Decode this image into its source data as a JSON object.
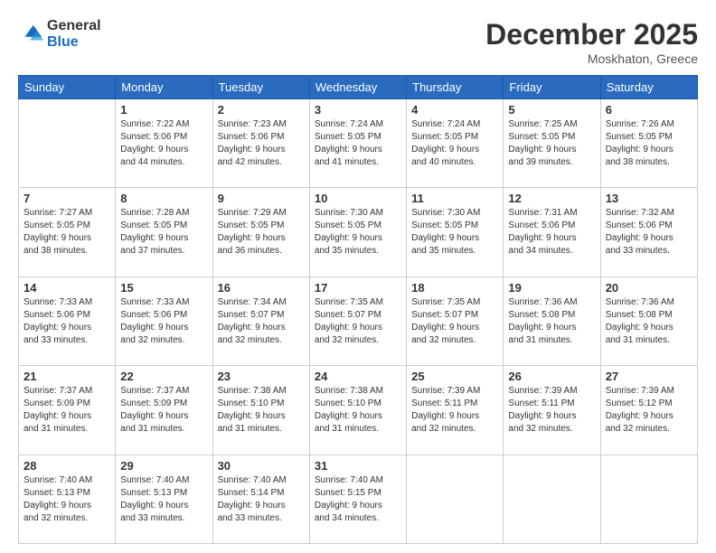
{
  "logo": {
    "general": "General",
    "blue": "Blue"
  },
  "header": {
    "month": "December 2025",
    "location": "Moskhaton, Greece"
  },
  "weekdays": [
    "Sunday",
    "Monday",
    "Tuesday",
    "Wednesday",
    "Thursday",
    "Friday",
    "Saturday"
  ],
  "weeks": [
    [
      {
        "day": "",
        "info": ""
      },
      {
        "day": "1",
        "info": "Sunrise: 7:22 AM\nSunset: 5:06 PM\nDaylight: 9 hours\nand 44 minutes."
      },
      {
        "day": "2",
        "info": "Sunrise: 7:23 AM\nSunset: 5:06 PM\nDaylight: 9 hours\nand 42 minutes."
      },
      {
        "day": "3",
        "info": "Sunrise: 7:24 AM\nSunset: 5:05 PM\nDaylight: 9 hours\nand 41 minutes."
      },
      {
        "day": "4",
        "info": "Sunrise: 7:24 AM\nSunset: 5:05 PM\nDaylight: 9 hours\nand 40 minutes."
      },
      {
        "day": "5",
        "info": "Sunrise: 7:25 AM\nSunset: 5:05 PM\nDaylight: 9 hours\nand 39 minutes."
      },
      {
        "day": "6",
        "info": "Sunrise: 7:26 AM\nSunset: 5:05 PM\nDaylight: 9 hours\nand 38 minutes."
      }
    ],
    [
      {
        "day": "7",
        "info": "Sunrise: 7:27 AM\nSunset: 5:05 PM\nDaylight: 9 hours\nand 38 minutes."
      },
      {
        "day": "8",
        "info": "Sunrise: 7:28 AM\nSunset: 5:05 PM\nDaylight: 9 hours\nand 37 minutes."
      },
      {
        "day": "9",
        "info": "Sunrise: 7:29 AM\nSunset: 5:05 PM\nDaylight: 9 hours\nand 36 minutes."
      },
      {
        "day": "10",
        "info": "Sunrise: 7:30 AM\nSunset: 5:05 PM\nDaylight: 9 hours\nand 35 minutes."
      },
      {
        "day": "11",
        "info": "Sunrise: 7:30 AM\nSunset: 5:05 PM\nDaylight: 9 hours\nand 35 minutes."
      },
      {
        "day": "12",
        "info": "Sunrise: 7:31 AM\nSunset: 5:06 PM\nDaylight: 9 hours\nand 34 minutes."
      },
      {
        "day": "13",
        "info": "Sunrise: 7:32 AM\nSunset: 5:06 PM\nDaylight: 9 hours\nand 33 minutes."
      }
    ],
    [
      {
        "day": "14",
        "info": "Sunrise: 7:33 AM\nSunset: 5:06 PM\nDaylight: 9 hours\nand 33 minutes."
      },
      {
        "day": "15",
        "info": "Sunrise: 7:33 AM\nSunset: 5:06 PM\nDaylight: 9 hours\nand 32 minutes."
      },
      {
        "day": "16",
        "info": "Sunrise: 7:34 AM\nSunset: 5:07 PM\nDaylight: 9 hours\nand 32 minutes."
      },
      {
        "day": "17",
        "info": "Sunrise: 7:35 AM\nSunset: 5:07 PM\nDaylight: 9 hours\nand 32 minutes."
      },
      {
        "day": "18",
        "info": "Sunrise: 7:35 AM\nSunset: 5:07 PM\nDaylight: 9 hours\nand 32 minutes."
      },
      {
        "day": "19",
        "info": "Sunrise: 7:36 AM\nSunset: 5:08 PM\nDaylight: 9 hours\nand 31 minutes."
      },
      {
        "day": "20",
        "info": "Sunrise: 7:36 AM\nSunset: 5:08 PM\nDaylight: 9 hours\nand 31 minutes."
      }
    ],
    [
      {
        "day": "21",
        "info": "Sunrise: 7:37 AM\nSunset: 5:09 PM\nDaylight: 9 hours\nand 31 minutes."
      },
      {
        "day": "22",
        "info": "Sunrise: 7:37 AM\nSunset: 5:09 PM\nDaylight: 9 hours\nand 31 minutes."
      },
      {
        "day": "23",
        "info": "Sunrise: 7:38 AM\nSunset: 5:10 PM\nDaylight: 9 hours\nand 31 minutes."
      },
      {
        "day": "24",
        "info": "Sunrise: 7:38 AM\nSunset: 5:10 PM\nDaylight: 9 hours\nand 31 minutes."
      },
      {
        "day": "25",
        "info": "Sunrise: 7:39 AM\nSunset: 5:11 PM\nDaylight: 9 hours\nand 32 minutes."
      },
      {
        "day": "26",
        "info": "Sunrise: 7:39 AM\nSunset: 5:11 PM\nDaylight: 9 hours\nand 32 minutes."
      },
      {
        "day": "27",
        "info": "Sunrise: 7:39 AM\nSunset: 5:12 PM\nDaylight: 9 hours\nand 32 minutes."
      }
    ],
    [
      {
        "day": "28",
        "info": "Sunrise: 7:40 AM\nSunset: 5:13 PM\nDaylight: 9 hours\nand 32 minutes."
      },
      {
        "day": "29",
        "info": "Sunrise: 7:40 AM\nSunset: 5:13 PM\nDaylight: 9 hours\nand 33 minutes."
      },
      {
        "day": "30",
        "info": "Sunrise: 7:40 AM\nSunset: 5:14 PM\nDaylight: 9 hours\nand 33 minutes."
      },
      {
        "day": "31",
        "info": "Sunrise: 7:40 AM\nSunset: 5:15 PM\nDaylight: 9 hours\nand 34 minutes."
      },
      {
        "day": "",
        "info": ""
      },
      {
        "day": "",
        "info": ""
      },
      {
        "day": "",
        "info": ""
      }
    ]
  ]
}
